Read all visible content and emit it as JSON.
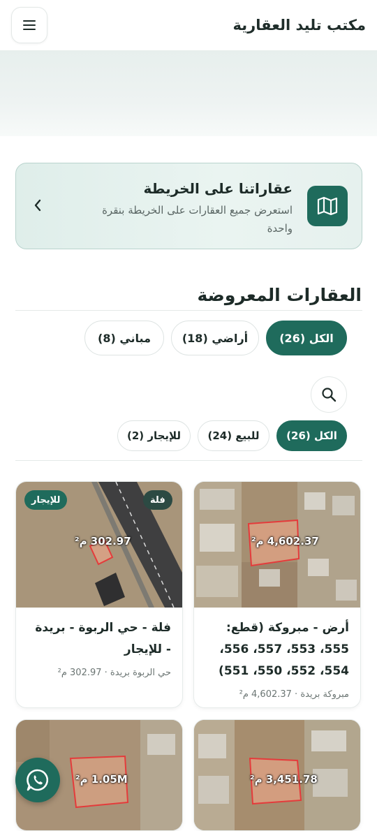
{
  "header": {
    "brand": "مكتب تليد العقارية",
    "menu_icon": "menu-icon"
  },
  "map_banner": {
    "title": "عقاراتنا على الخريطة",
    "description": "استعرض جميع العقارات على الخريطة بنقرة واحدة",
    "icon": "map-icon",
    "chevron": "chevron-left-icon"
  },
  "section": {
    "title": "العقارات المعروضة"
  },
  "type_filters": [
    {
      "label": "الكل (26)",
      "active": true
    },
    {
      "label": "أراضي (18)",
      "active": false
    },
    {
      "label": "مباني (8)",
      "active": false
    }
  ],
  "search": {
    "icon": "search-icon"
  },
  "deal_filters": [
    {
      "label": "الكل (26)",
      "active": true
    },
    {
      "label": "للبيع (24)",
      "active": false
    },
    {
      "label": "للإيجار (2)",
      "active": false
    }
  ],
  "listings": [
    {
      "area_label": "4,602.37 م²",
      "title": "أرض - مبروكة (قطع: 555، 553، 557، 556، 554، 552، 550، 551)",
      "meta": "مبروكة بريدة · 4,602.37 م²"
    },
    {
      "area_label": "302.97 م²",
      "type_badge": "فلة",
      "deal_badge": "للإيجار",
      "title": "فلة - حي الربوة - بريدة - للإيجار",
      "meta": "حي الربوة بريدة · 302.97 م²"
    },
    {
      "area_label": "3,451.78 م²"
    },
    {
      "area_label": "1.05M م²"
    }
  ],
  "whatsapp": {
    "icon": "whatsapp-icon"
  },
  "colors": {
    "primary": "#1f6b5c",
    "accent_light": "#dfeeea"
  }
}
